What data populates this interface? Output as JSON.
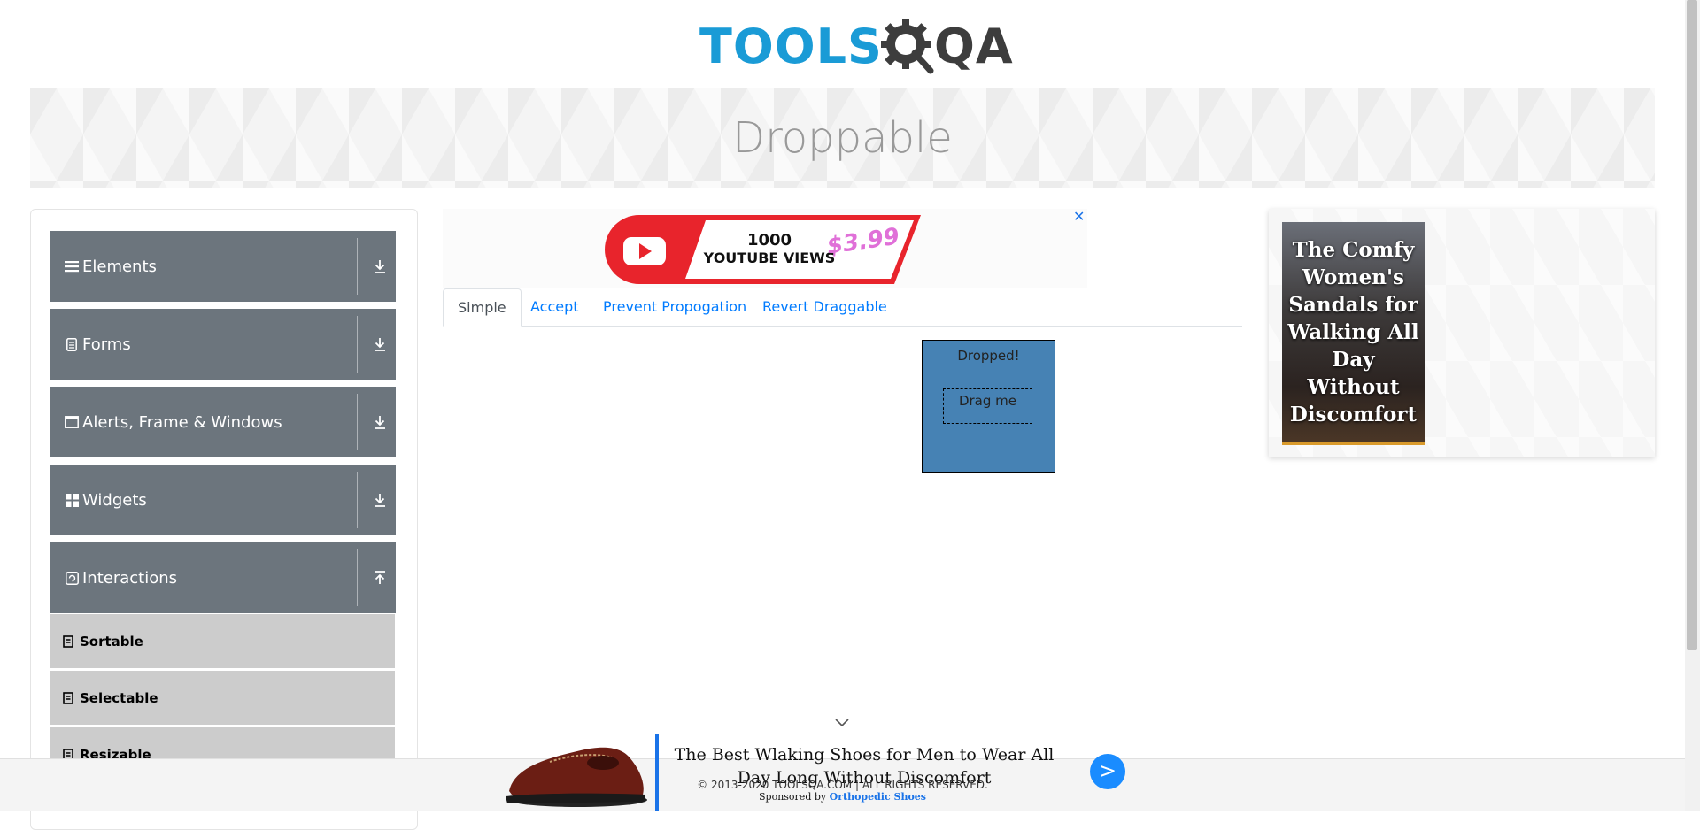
{
  "header": {
    "logo_part1": "TOOLS",
    "logo_part2": "QA",
    "page_title": "Droppable"
  },
  "sidebar": {
    "groups": [
      {
        "label": "Elements",
        "icon": "hamburger-icon",
        "arrow": "download-arrow-icon"
      },
      {
        "label": "Forms",
        "icon": "form-icon",
        "arrow": "download-arrow-icon"
      },
      {
        "label": "Alerts, Frame & Windows",
        "icon": "window-icon",
        "arrow": "download-arrow-icon"
      },
      {
        "label": "Widgets",
        "icon": "grid-icon",
        "arrow": "download-arrow-icon"
      },
      {
        "label": "Interactions",
        "icon": "refresh-icon",
        "arrow": "upload-arrow-icon"
      }
    ],
    "interaction_items": [
      {
        "label": "Sortable"
      },
      {
        "label": "Selectable"
      },
      {
        "label": "Resizable"
      }
    ]
  },
  "ad_top": {
    "line1": "1000",
    "line2": "YOUTUBE VIEWS",
    "price": "$3.99",
    "close": "✕"
  },
  "tabs": [
    {
      "label": "Simple",
      "active": true
    },
    {
      "label": "Accept",
      "active": false
    },
    {
      "label": "Prevent Propogation",
      "active": false
    },
    {
      "label": "Revert Draggable",
      "active": false
    }
  ],
  "droppable": {
    "drop_text": "Dropped!",
    "drag_text": "Drag me",
    "drop_color": "#4682b4"
  },
  "ad_right": {
    "text": "The Comfy Women's Sandals for Walking All Day Without Discomfort"
  },
  "footer": {
    "copyright": "© 2013-2020 TOOLSQA.COM | ALL RIGHTS RESERVED."
  },
  "ad_bottom": {
    "headline": "The Best Wlaking Shoes for Men to Wear All Day Long Without Discomfort",
    "go_label": ">",
    "sponsored_prefix": "Sponsored by",
    "sponsor": "Orthopedic Shoes"
  },
  "colors": {
    "brand_blue": "#1a9bd6",
    "sidebar_group": "#6c757d",
    "sidebar_item": "#cccccc",
    "link": "#007bff"
  }
}
